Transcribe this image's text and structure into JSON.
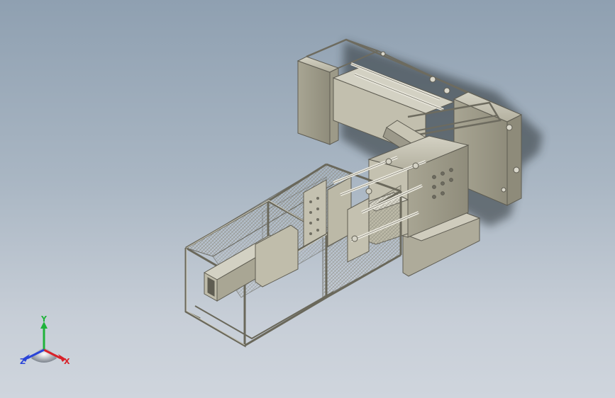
{
  "viewport": {
    "background_top": "#8fa0b1",
    "background_bottom": "#cfd5dd",
    "model_color": "#b9b6a4",
    "model_shadow_color": "#30343a"
  },
  "triad": {
    "x_label": "X",
    "y_label": "Y",
    "z_label": "Z",
    "x_color": "#d8222a",
    "y_color": "#1fb33a",
    "z_color": "#2a44d8"
  }
}
